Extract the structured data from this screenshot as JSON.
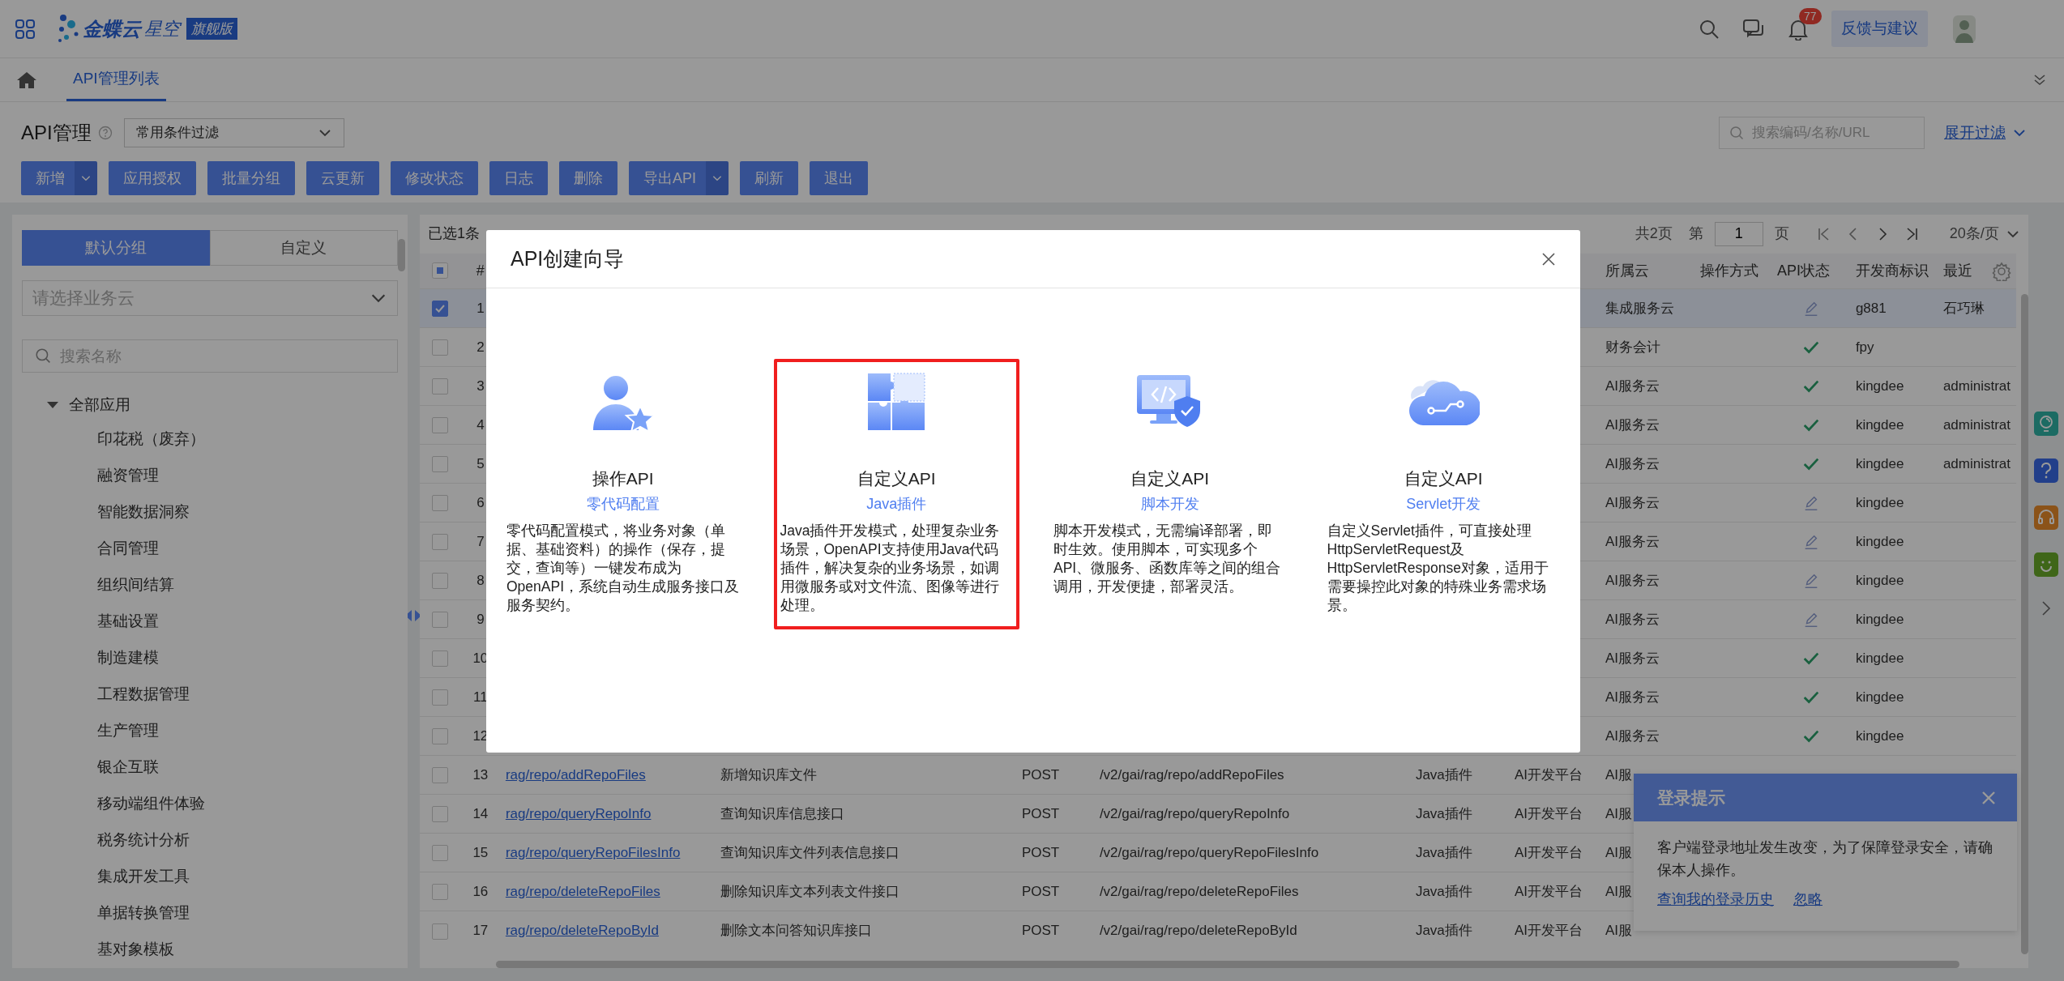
{
  "top_bar": {
    "logo": {
      "brand": "金蝶云",
      "product": "星空",
      "edition": "旗舰版"
    },
    "notification_count": "77",
    "feedback_button": "反馈与建议"
  },
  "tabs": [
    {
      "label": "API管理列表",
      "selected": true
    }
  ],
  "page": {
    "title": "API管理",
    "filter_select": "常用条件过滤",
    "search": {
      "placeholder": "搜索编码/名称/URL"
    },
    "expand_filter": "展开过滤"
  },
  "toolbar": [
    {
      "label": "新增",
      "split": true
    },
    {
      "label": "应用授权",
      "split": false
    },
    {
      "label": "批量分组",
      "split": false
    },
    {
      "label": "云更新",
      "split": false
    },
    {
      "label": "修改状态",
      "split": false
    },
    {
      "label": "日志",
      "split": false
    },
    {
      "label": "删除",
      "split": false
    },
    {
      "label": "导出API",
      "split": true
    },
    {
      "label": "刷新",
      "split": false
    },
    {
      "label": "退出",
      "split": false
    }
  ],
  "sidebar": {
    "segments": [
      {
        "label": "默认分组",
        "selected": true
      },
      {
        "label": "自定义",
        "selected": false
      }
    ],
    "cloud_select": {
      "placeholder": "请选择业务云"
    },
    "search": {
      "placeholder": "搜索名称"
    },
    "tree": [
      {
        "label": "全部应用",
        "expanded": true,
        "children": [
          {
            "label": "印花税（废弃）"
          },
          {
            "label": "融资管理"
          },
          {
            "label": "智能数据洞察"
          },
          {
            "label": "合同管理"
          },
          {
            "label": "组织间结算"
          },
          {
            "label": "基础设置"
          },
          {
            "label": "制造建模"
          },
          {
            "label": "工程数据管理"
          },
          {
            "label": "生产管理"
          },
          {
            "label": "银企互联"
          },
          {
            "label": "移动端组件体验"
          },
          {
            "label": "税务统计分析"
          },
          {
            "label": "集成开发工具"
          },
          {
            "label": "单据转换管理"
          },
          {
            "label": "基对象模板"
          }
        ]
      }
    ]
  },
  "table": {
    "selection_info": "已选1条",
    "pagination": {
      "total": "共2页",
      "page_prefix": "第",
      "page": "1",
      "page_suffix": "页",
      "page_size": "20条/页"
    },
    "select_all_indeterminate": true,
    "header": {
      "number": "#",
      "cloud": "所属云",
      "operation": "操作方式",
      "api_status": "API状态",
      "developer": "开发商标识",
      "recent": "最近"
    },
    "rows": [
      {
        "selected": true,
        "number": "1",
        "cloud": "集成服务云",
        "published": false,
        "developer": "g881",
        "recent": "石巧琳"
      },
      {
        "selected": false,
        "number": "2",
        "cloud": "财务会计",
        "published": true,
        "developer": "fpy"
      },
      {
        "selected": false,
        "number": "3",
        "cloud": "AI服务云",
        "published": true,
        "developer": "kingdee",
        "recent": "administrat"
      },
      {
        "selected": false,
        "number": "4",
        "cloud": "AI服务云",
        "published": true,
        "developer": "kingdee",
        "recent": "administrat"
      },
      {
        "selected": false,
        "number": "5",
        "cloud": "AI服务云",
        "published": true,
        "developer": "kingdee",
        "recent": "administrat"
      },
      {
        "selected": false,
        "number": "6",
        "cloud": "AI服务云",
        "published": false,
        "developer": "kingdee"
      },
      {
        "selected": false,
        "number": "7",
        "cloud": "AI服务云",
        "published": false,
        "developer": "kingdee"
      },
      {
        "selected": false,
        "number": "8",
        "cloud": "AI服务云",
        "published": false,
        "developer": "kingdee"
      },
      {
        "selected": false,
        "number": "9",
        "cloud": "AI服务云",
        "published": false,
        "developer": "kingdee"
      },
      {
        "selected": false,
        "number": "10",
        "cloud": "AI服务云",
        "published": true,
        "developer": "kingdee"
      },
      {
        "selected": false,
        "number": "11",
        "cloud": "AI服务云",
        "published": true,
        "developer": "kingdee"
      },
      {
        "selected": false,
        "number": "12",
        "cloud": "AI服务云",
        "published": true,
        "developer": "kingdee"
      },
      {
        "selected": false,
        "number": "13",
        "column_3": "rag/repo/addRepoFiles",
        "column_4": "新增知识库文件",
        "column_5": "POST",
        "column_6": "/v2/gai/rag/repo/addRepoFiles",
        "column_7": "Java插件",
        "column_8": "AI开发平台",
        "cloud": "AI服"
      },
      {
        "selected": false,
        "number": "14",
        "column_3": "rag/repo/queryRepoInfo",
        "column_4": "查询知识库信息接口",
        "column_5": "POST",
        "column_6": "/v2/gai/rag/repo/queryRepoInfo",
        "column_7": "Java插件",
        "column_8": "AI开发平台",
        "cloud": "AI服"
      },
      {
        "selected": false,
        "number": "15",
        "column_3": "rag/repo/queryRepoFilesInfo",
        "column_4": "查询知识库文件列表信息接口",
        "column_5": "POST",
        "column_6": "/v2/gai/rag/repo/queryRepoFilesInfo",
        "column_7": "Java插件",
        "column_8": "AI开发平台",
        "cloud": "AI服"
      },
      {
        "selected": false,
        "number": "16",
        "column_3": "rag/repo/deleteRepoFiles",
        "column_4": "删除知识库文本列表文件接口",
        "column_5": "POST",
        "column_6": "/v2/gai/rag/repo/deleteRepoFiles",
        "column_7": "Java插件",
        "column_8": "AI开发平台",
        "cloud": "AI服"
      },
      {
        "selected": false,
        "number": "17",
        "column_3": "rag/repo/deleteRepoById",
        "column_4": "删除文本问答知识库接口",
        "column_5": "POST",
        "column_6": "/v2/gai/rag/repo/deleteRepoById",
        "column_7": "Java插件",
        "column_8": "AI开发平台",
        "cloud": "AI服"
      }
    ]
  },
  "login_notice": {
    "title": "登录提示",
    "message": "客户端登录地址发生改变，为了保障登录安全，请确保本人操作。",
    "links": [
      "查询我的登录历史",
      "忽略"
    ]
  },
  "modal": {
    "title": "API创建向导",
    "cards": [
      {
        "kind": "operation",
        "title": "操作API",
        "subtitle": "零代码配置",
        "description": "零代码配置模式，将业务对象（单据、基础资料）的操作（保存，提交，查询等）一键发布成为OpenAPI，系统自动生成服务接口及服务契约。",
        "highlighted": false
      },
      {
        "kind": "plugin",
        "title": "自定义API",
        "subtitle": "Java插件",
        "description": "Java插件开发模式，处理复杂业务场景，OpenAPI支持使用Java代码插件，解决复杂的业务场景，如调用微服务或对文件流、图像等进行处理。",
        "highlighted": true
      },
      {
        "kind": "script",
        "title": "自定义API",
        "subtitle": "脚本开发",
        "description": "脚本开发模式，无需编译部署，即时生效。使用脚本，可实现多个API、微服务、函数库等之间的组合调用，开发便捷，部署灵活。",
        "highlighted": false
      },
      {
        "kind": "servlet",
        "title": "自定义API",
        "subtitle": "Servlet开发",
        "description": "自定义Servlet插件，可直接处理HttpServletRequest及HttpServletResponse对象，适用于需要操控此对象的特殊业务需求场景。",
        "highlighted": false
      }
    ]
  }
}
